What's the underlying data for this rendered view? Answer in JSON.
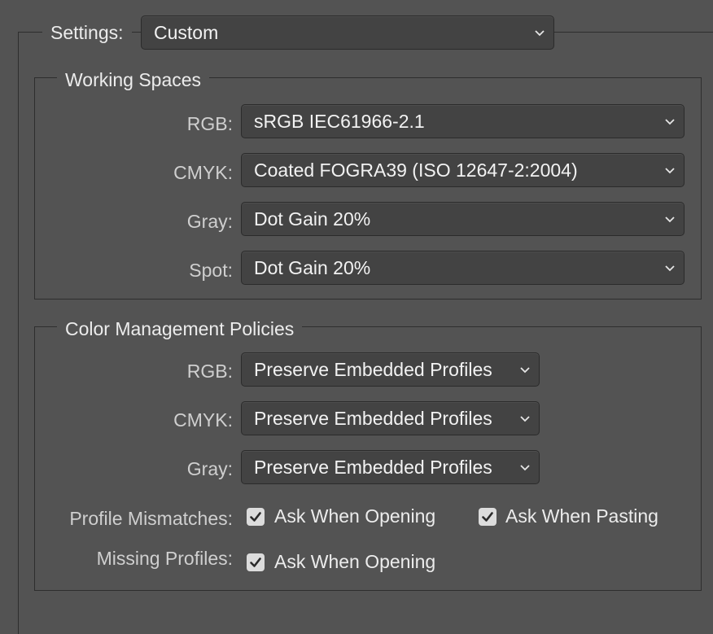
{
  "settings": {
    "label": "Settings:",
    "value": "Custom"
  },
  "working_spaces": {
    "title": "Working Spaces",
    "rows": [
      {
        "label": "RGB:",
        "value": "sRGB IEC61966-2.1"
      },
      {
        "label": "CMYK:",
        "value": "Coated FOGRA39 (ISO 12647-2:2004)"
      },
      {
        "label": "Gray:",
        "value": "Dot Gain 20%"
      },
      {
        "label": "Spot:",
        "value": "Dot Gain 20%"
      }
    ]
  },
  "policies": {
    "title": "Color Management Policies",
    "rows": [
      {
        "label": "RGB:",
        "value": "Preserve Embedded Profiles"
      },
      {
        "label": "CMYK:",
        "value": "Preserve Embedded Profiles"
      },
      {
        "label": "Gray:",
        "value": "Preserve Embedded Profiles"
      }
    ],
    "profile_mismatches": {
      "label": "Profile Mismatches:",
      "ask_opening": {
        "label": "Ask When Opening",
        "checked": true
      },
      "ask_pasting": {
        "label": "Ask When Pasting",
        "checked": true
      }
    },
    "missing_profiles": {
      "label": "Missing Profiles:",
      "ask_opening": {
        "label": "Ask When Opening",
        "checked": true
      }
    }
  },
  "colors": {
    "background": "#535353",
    "field": "#434343",
    "checkbox": "#dcdcdc"
  }
}
